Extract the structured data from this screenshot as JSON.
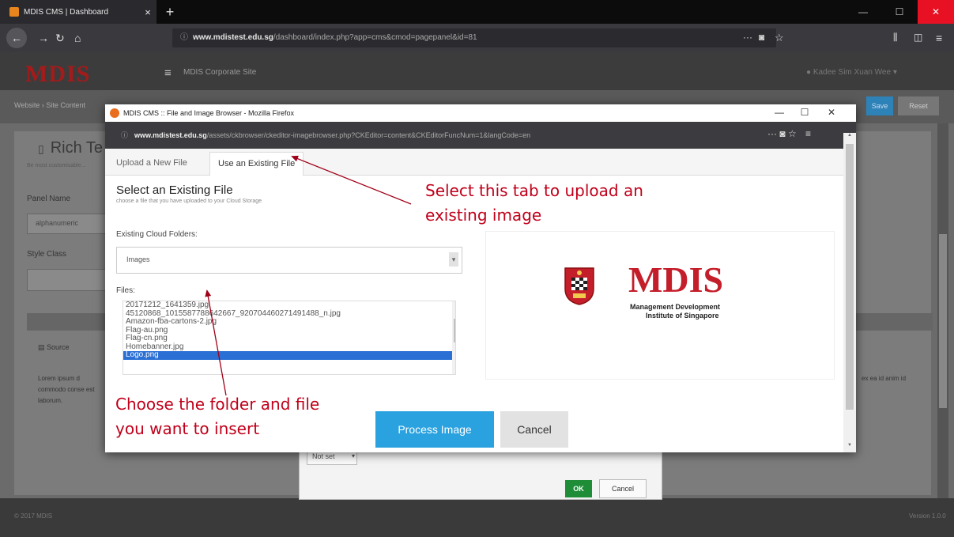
{
  "browser": {
    "tab_title": "MDIS CMS | Dashboard",
    "tab_close": "×",
    "new_tab": "+",
    "url_domain": "www.mdistest.edu.sg",
    "url_path": "/dashboard/index.php?app=cms&cmod=pagepanel&id=81"
  },
  "cms": {
    "logo": "MDIS",
    "nav_link": "MDIS Corporate Site",
    "user": "Kadee Sim Xuan Wee",
    "breadcrumb": "Website  ›  Site Content",
    "save_label": "Save",
    "reset_label": "Reset",
    "panel_title": "Rich Te",
    "panel_subtitle": "Be most customisable...",
    "panel_name_label": "Panel Name",
    "panel_name_value": "alphanumeric",
    "style_class_label": "Style Class",
    "editor_source": "Source",
    "lorem_left": "Lorem ipsum d commodo conse est laborum.",
    "lorem_right": "ex ea id anim id",
    "copyright": "© 2017 MDIS",
    "version": "Version 1.0.0"
  },
  "ckeditor_dialog": {
    "select_value": "Not set",
    "ok_label": "OK",
    "cancel_label": "Cancel"
  },
  "popup": {
    "window_title": "MDIS CMS :: File and Image Browser - Mozilla Firefox",
    "url_domain": "www.mdistest.edu.sg",
    "url_path": "/assets/ckbrowser/ckeditor-imagebrowser.php?CKEditor=content&CKEditorFuncNum=1&langCode=en",
    "tabs": [
      "Upload a New File",
      "Use an Existing File"
    ],
    "active_tab": 1,
    "section_title": "Select an Existing File",
    "section_subtitle": "choose a file that you have uploaded to your Cloud Storage",
    "folders_label": "Existing Cloud Folders:",
    "folder_selected": "Images",
    "files_label": "Files:",
    "files": [
      "20171212_1641359.jpg",
      "45120868_1015587788642667_920704460271491488_n.jpg",
      "Amazon-fba-cartons-2.jpg",
      "Flag-au.png",
      "Flag-cn.png",
      "Homebanner.jpg",
      "Logo.png"
    ],
    "selected_file_index": 6,
    "preview": {
      "logo_text": "MDIS",
      "line1": "Management Development",
      "line2": "Institute of Singapore"
    },
    "process_label": "Process Image",
    "cancel_label": "Cancel"
  },
  "annotations": {
    "tab_hint": "Select this tab to upload an existing image",
    "file_hint": "Choose the folder and file you want to insert"
  },
  "colors": {
    "annotation_red": "#c0001a",
    "process_blue": "#2aa2e0",
    "mdis_red": "#c41e2a",
    "selection_blue": "#2a6fd4"
  }
}
